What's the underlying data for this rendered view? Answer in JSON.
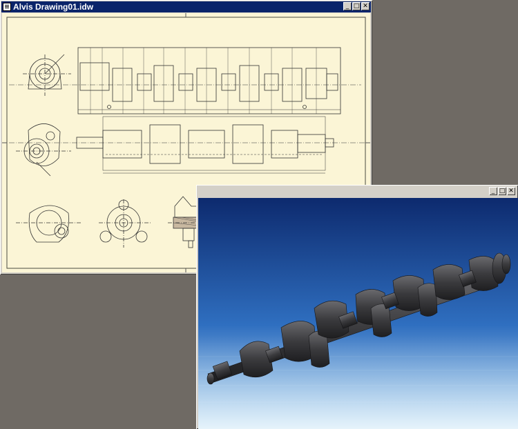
{
  "windows": {
    "drawing": {
      "title": "Alvis Drawing01.idw",
      "minimize_glyph": "_",
      "maximize_glyph": "□",
      "close_glyph": "✕"
    },
    "render": {
      "title": "",
      "minimize_glyph": "_",
      "maximize_glyph": "□",
      "close_glyph": "✕"
    }
  },
  "colors": {
    "desktop": "#6f6a64",
    "sheet": "#fbf5d6",
    "title_active": "#0a246a",
    "render_sky": "#1b3f8c",
    "crankshaft": "#3a3a3c"
  },
  "icons": [
    "window-menu-icon",
    "minimize-icon",
    "maximize-icon",
    "close-icon"
  ]
}
